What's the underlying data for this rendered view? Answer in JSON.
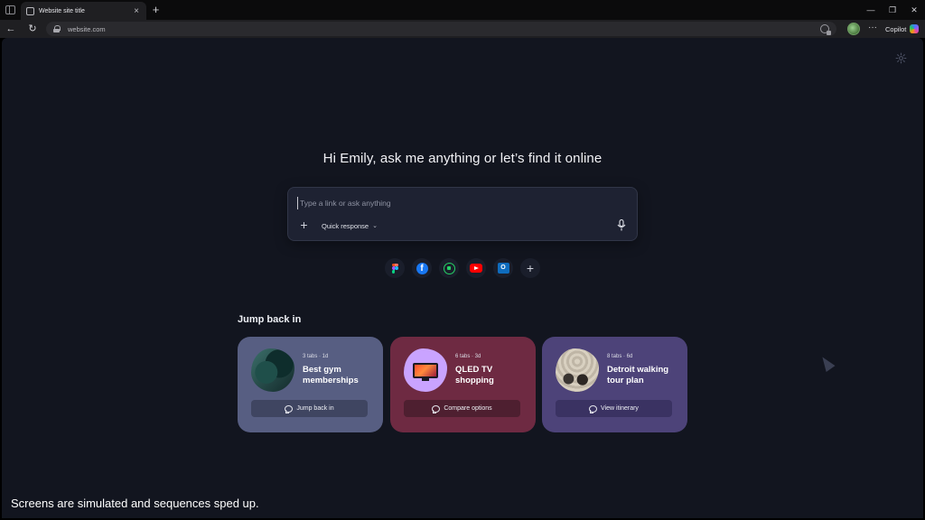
{
  "browser": {
    "tab_title": "Website site title",
    "tab_close": "×",
    "new_tab": "+",
    "url": "website.com",
    "copilot_label": "Copilot",
    "more": "···",
    "minimize": "—",
    "restore": "❐",
    "close": "✕",
    "back": "←",
    "reload": "↻"
  },
  "home": {
    "greeting": "Hi Emily, ask me anything or let’s find it online",
    "composer": {
      "placeholder": "Type a link or ask anything",
      "add": "+",
      "mode_label": "Quick response",
      "mode_chevron": "⌄"
    },
    "shortcuts": [
      {
        "name": "Figma",
        "icon": "figma-icon"
      },
      {
        "name": "Facebook",
        "icon": "facebook-icon",
        "glyph": "f"
      },
      {
        "name": "WhatsApp",
        "icon": "whatsapp-icon"
      },
      {
        "name": "YouTube",
        "icon": "youtube-icon"
      },
      {
        "name": "Outlook",
        "icon": "outlook-icon",
        "glyph": "O"
      },
      {
        "name": "Add shortcut",
        "icon": "plus-icon",
        "glyph": "+"
      }
    ],
    "jump_back_in": {
      "heading": "Jump back in",
      "cards": [
        {
          "meta": "3 tabs · 1d",
          "title": "Best gym memberships",
          "action": "Jump back in",
          "color": "#575e82"
        },
        {
          "meta": "6 tabs · 3d",
          "title": "QLED TV shopping",
          "action": "Compare options",
          "color": "#6e2a42"
        },
        {
          "meta": "8 tabs · 6d",
          "title": "Detroit walking tour plan",
          "action": "View itinerary",
          "color": "#4d4379"
        }
      ]
    }
  },
  "footer": {
    "disclaimer": "Screens are simulated and sequences sped up."
  },
  "colors": {
    "page_bg": "#12151f",
    "chrome_bg": "#1f1f22",
    "accent": "#3b82f6"
  }
}
